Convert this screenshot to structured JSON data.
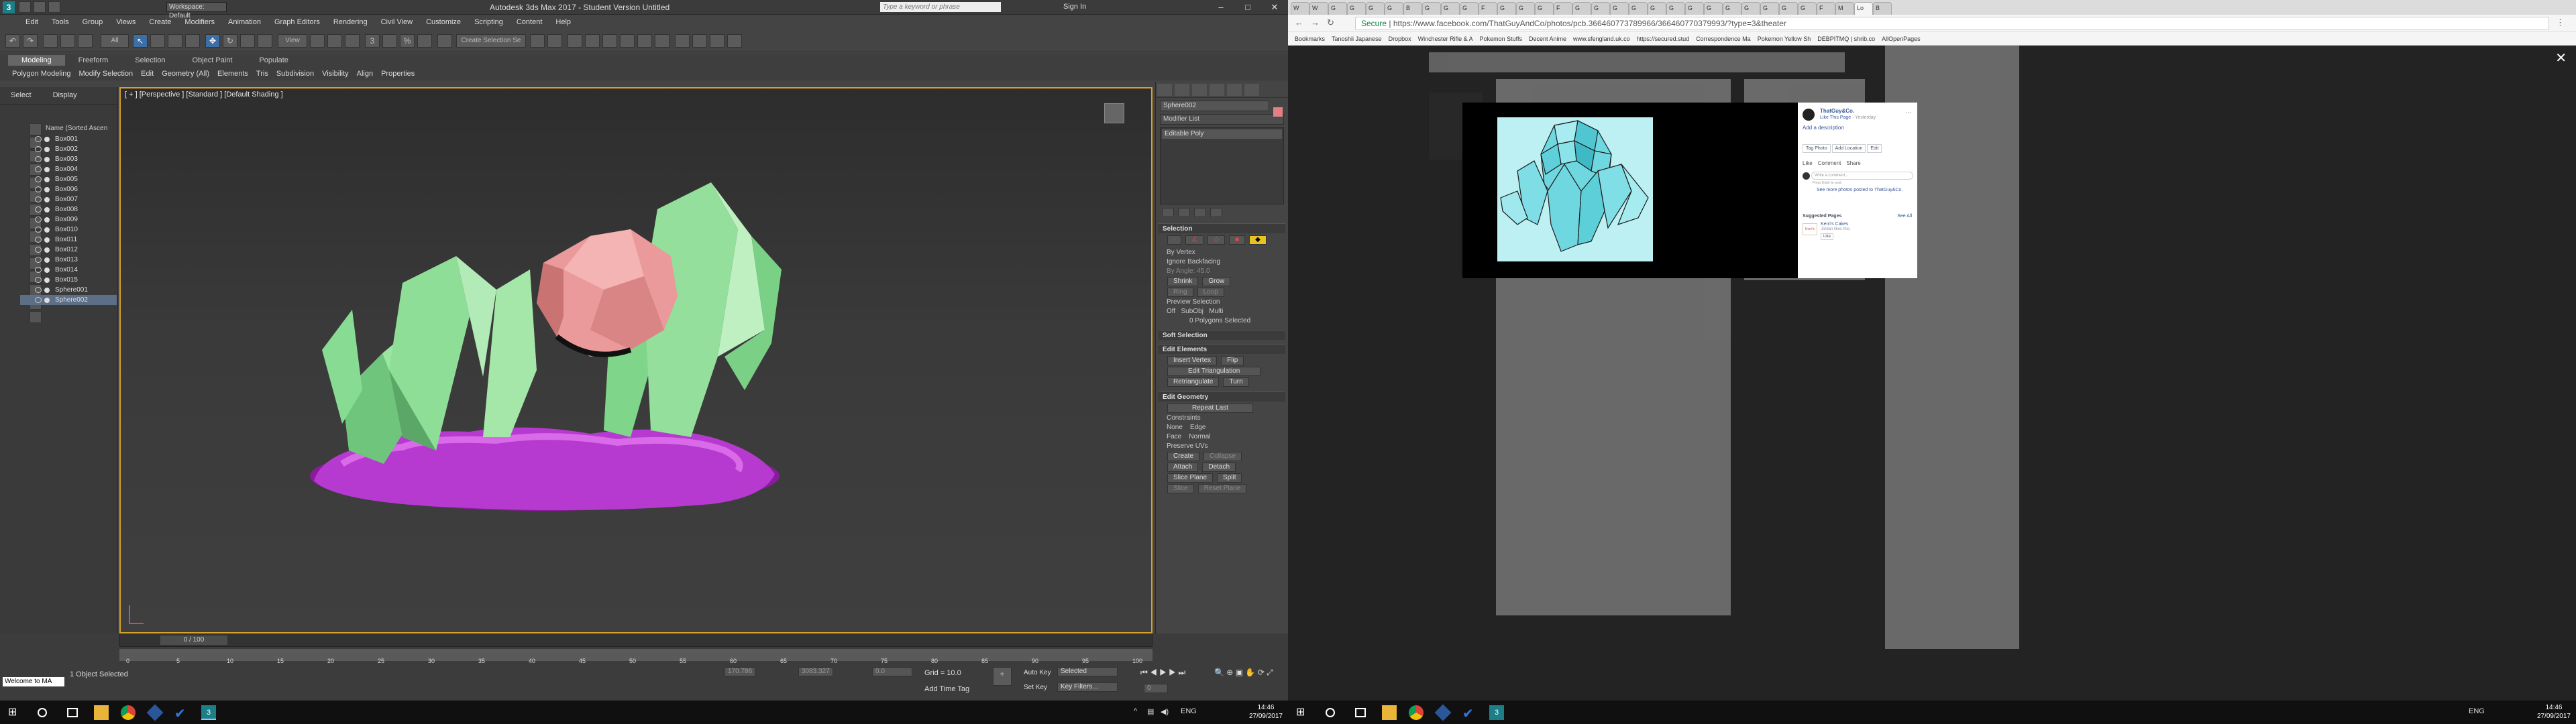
{
  "left": {
    "title_bar": {
      "workspace": "Workspace: Default",
      "title": "Autodesk 3ds Max 2017 - Student Version   Untitled",
      "search_placeholder": "Type a keyword or phrase",
      "signin": "Sign In"
    },
    "menu": [
      "Edit",
      "Tools",
      "Group",
      "Views",
      "Create",
      "Modifiers",
      "Animation",
      "Graph Editors",
      "Rendering",
      "Civil View",
      "Customize",
      "Scripting",
      "Content",
      "Help"
    ],
    "toolbar": {
      "filter": "All",
      "view": "View",
      "selection_set": "Create Selection Se"
    },
    "ribbon": {
      "tabs": [
        "Modeling",
        "Freeform",
        "Selection",
        "Object Paint",
        "Populate"
      ],
      "sub": [
        "Polygon Modeling",
        "Modify Selection",
        "Edit",
        "Geometry (All)",
        "Elements",
        "Tris",
        "Subdivision",
        "Visibility",
        "Align",
        "Properties"
      ]
    },
    "scene_explorer": {
      "tabs": [
        "Select",
        "Display"
      ],
      "header": "Name (Sorted Ascen",
      "items": [
        "Box001",
        "Box002",
        "Box003",
        "Box004",
        "Box005",
        "Box006",
        "Box007",
        "Box008",
        "Box009",
        "Box010",
        "Box011",
        "Box012",
        "Box013",
        "Box014",
        "Box015",
        "Sphere001",
        "Sphere002"
      ]
    },
    "viewport": {
      "label": "[ + ] [Perspective ] [Standard ] [Default Shading ]"
    },
    "command_panel": {
      "object_name": "Sphere002",
      "modifier_list": "Modifier List",
      "stack_item": "Editable Poly",
      "selection": {
        "title": "Selection",
        "by_vertex": "By Vertex",
        "ignore_backfacing": "Ignore Backfacing",
        "by_angle": "By Angle:",
        "angle": "45.0",
        "shrink": "Shrink",
        "grow": "Grow",
        "ring": "Ring",
        "loop": "Loop",
        "preview": "Preview Selection",
        "off": "Off",
        "subobj": "SubObj",
        "multi": "Multi",
        "status": "0 Polygons Selected"
      },
      "soft_selection": "Soft Selection",
      "edit_elements": {
        "title": "Edit Elements",
        "insert_vertex": "Insert Vertex",
        "flip": "Flip",
        "edit_tri": "Edit Triangulation",
        "retriangulate": "Retriangulate",
        "turn": "Turn"
      },
      "edit_geometry": {
        "title": "Edit Geometry",
        "repeat_last": "Repeat Last",
        "constraints": "Constraints",
        "none": "None",
        "edge": "Edge",
        "face": "Face",
        "normal": "Normal",
        "preserve_uvs": "Preserve UVs",
        "create": "Create",
        "collapse": "Collapse",
        "attach": "Attach",
        "detach": "Detach",
        "slice_plane": "Slice Plane",
        "split": "Split",
        "slice": "Slice",
        "reset_plane": "Reset Plane"
      }
    },
    "timeline": {
      "frame": "0 / 100",
      "ticks": [
        "0",
        "5",
        "10",
        "15",
        "20",
        "25",
        "30",
        "35",
        "40",
        "45",
        "50",
        "55",
        "60",
        "65",
        "70",
        "75",
        "80",
        "85",
        "90",
        "95",
        "100"
      ]
    },
    "status": {
      "maxscript": "Welcome to MA",
      "objects": "1 Object Selected",
      "x": "170.786",
      "y": "3083.327",
      "z": "0.0",
      "grid": "Grid = 10.0",
      "add_time_tag": "Add Time Tag",
      "auto_key": "Auto Key",
      "selected": "Selected",
      "set_key": "Set Key",
      "key_filters": "Key Filters...",
      "frame_field": "0"
    },
    "taskbar": {
      "lang": "ENG",
      "time": "14:46",
      "date": "27/09/2017"
    }
  },
  "right": {
    "tabs": [
      "W",
      "W",
      "G",
      "G",
      "G",
      "G",
      "B",
      "G",
      "G",
      "G",
      "F",
      "G",
      "G",
      "G",
      "F",
      "G",
      "G",
      "G",
      "G",
      "G",
      "G",
      "G",
      "G",
      "G",
      "G",
      "G",
      "G",
      "G",
      "F",
      "M",
      "Lo",
      "B"
    ],
    "address": {
      "secure": "Secure",
      "url": "https://www.facebook.com/ThatGuyAndCo/photos/pcb.366460773789966/366460770379993/?type=3&theater"
    },
    "bookmarks": [
      "Bookmarks",
      "Tanoshii Japanese",
      "Dropbox",
      "Winchester Rifle & A",
      "Pokemon Stuffs",
      "Decent Anime",
      "www.sfengland.uk.co",
      "https://secured.stud",
      "Correspondence Ma",
      "Pokemon Yellow Sh",
      "DEBPITMQ | shrib.co",
      "AllOpenPages"
    ],
    "post": {
      "page_name": "ThatGuy&Co.",
      "like_page": "Like This Page",
      "time": "Yesterday",
      "add_description": "Add a description",
      "tag_photo": "Tag Photo",
      "add_location": "Add Location",
      "edit": "Edit",
      "like": "Like",
      "comment": "Comment",
      "share": "Share",
      "write_comment": "Write a comment...",
      "press_enter": "Press Enter to post.",
      "see_more": "See more photos posted to ThatGuy&Co.",
      "suggested": "Suggested Pages",
      "see_all": "See All",
      "kerri_name": "Kerri's Cakes",
      "kerri_likes": "Jordan likes this.",
      "kerri_like_btn": "Like",
      "kerri_logo": "Kerri's"
    },
    "taskbar": {
      "lang": "ENG",
      "time": "14:46",
      "date": "27/09/2017"
    }
  }
}
